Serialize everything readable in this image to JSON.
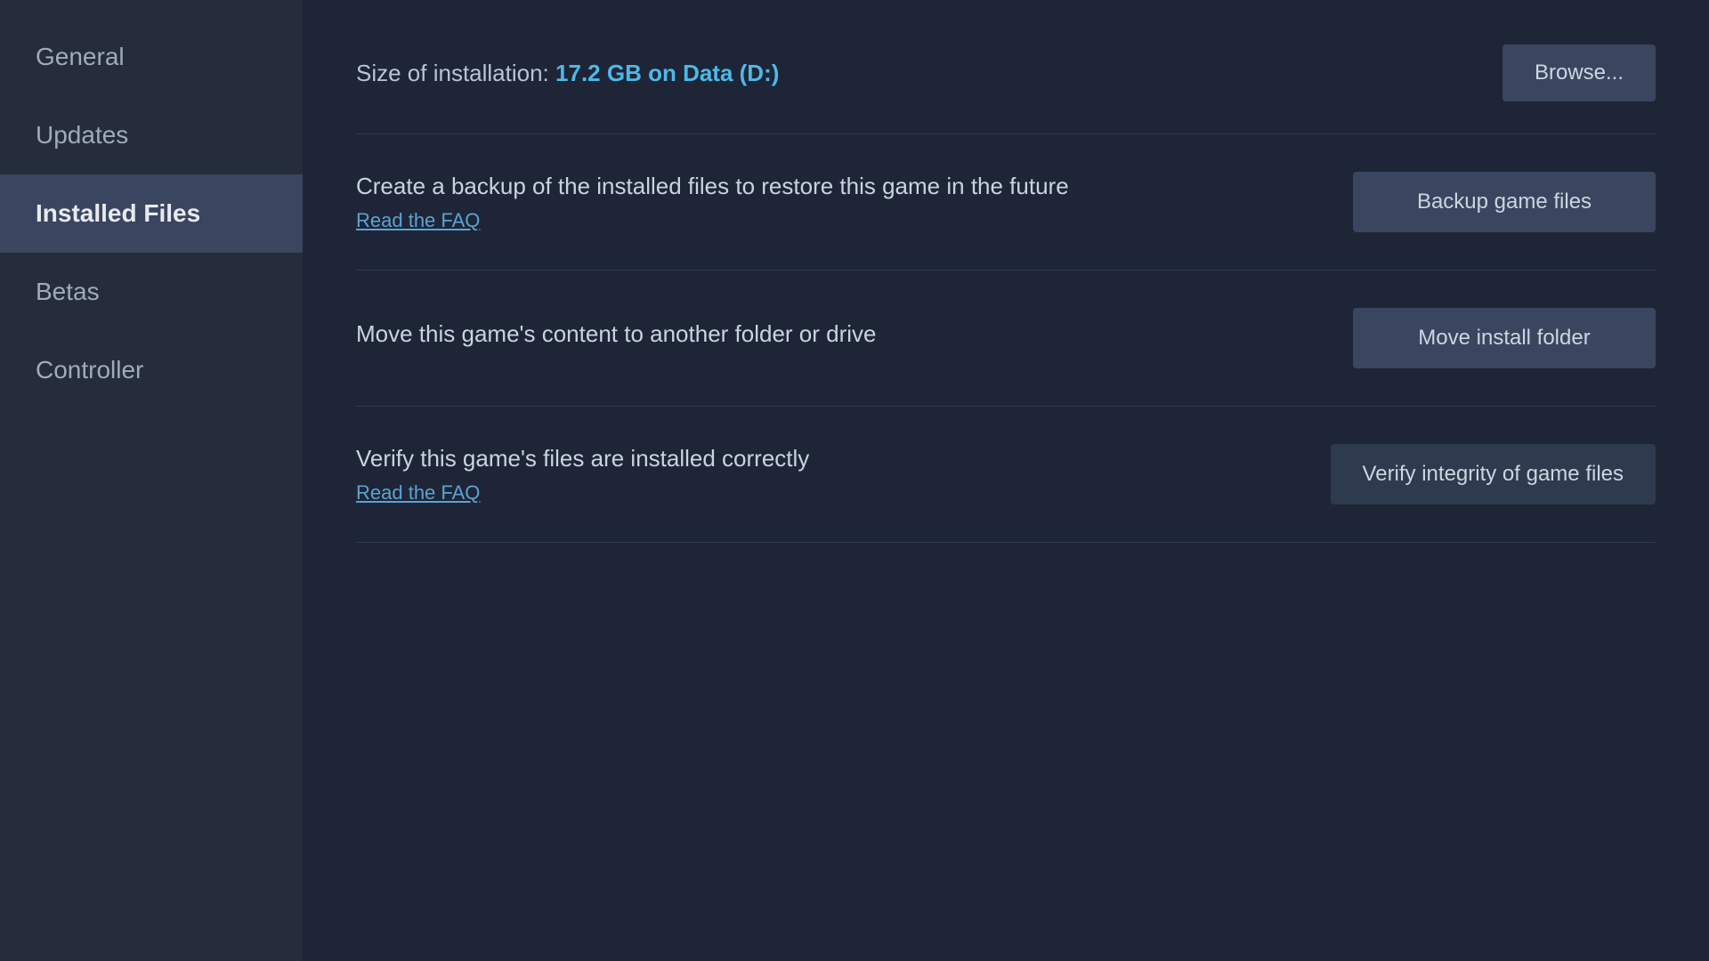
{
  "sidebar": {
    "items": [
      {
        "id": "general",
        "label": "General",
        "active": false
      },
      {
        "id": "updates",
        "label": "Updates",
        "active": false
      },
      {
        "id": "installed-files",
        "label": "Installed Files",
        "active": true
      },
      {
        "id": "betas",
        "label": "Betas",
        "active": false
      },
      {
        "id": "controller",
        "label": "Controller",
        "active": false
      }
    ]
  },
  "main": {
    "size_label": "Size of installation:",
    "size_value": "17.2 GB on Data (D:)",
    "browse_button": "Browse...",
    "sections": [
      {
        "id": "backup",
        "description": "Create a backup of the installed files to restore this game in the future",
        "link_text": "Read the FAQ",
        "button_label": "Backup game files"
      },
      {
        "id": "move",
        "description": "Move this game's content to another folder or drive",
        "link_text": null,
        "button_label": "Move install folder"
      },
      {
        "id": "verify",
        "description": "Verify this game's files are installed correctly",
        "link_text": "Read the FAQ",
        "button_label": "Verify integrity of game files"
      }
    ]
  }
}
